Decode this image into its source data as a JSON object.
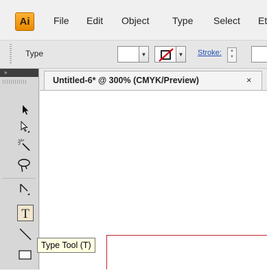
{
  "app": {
    "logo_text": "Ai",
    "accent_color": "#f7a21b"
  },
  "menu": {
    "items": [
      "File",
      "Edit",
      "Object",
      "Type",
      "Select",
      "Et"
    ]
  },
  "control_bar": {
    "tool_label": "Type",
    "stroke_label": "Stroke:"
  },
  "tools_panel": {
    "collapse_glyph": "»",
    "icons": [
      "selection-tool-icon",
      "direct-selection-tool-icon",
      "magic-wand-tool-icon",
      "lasso-tool-icon",
      "pen-tool-icon",
      "type-tool-icon",
      "line-segment-tool-icon",
      "rectangle-tool-icon"
    ],
    "active_tool": "type-tool"
  },
  "document": {
    "tab_title": "Untitled-6* @ 300% (CMYK/Preview)",
    "close_glyph": "×",
    "artboard_color": "#c3202c"
  },
  "tooltip": {
    "text": "Type Tool (T)"
  }
}
